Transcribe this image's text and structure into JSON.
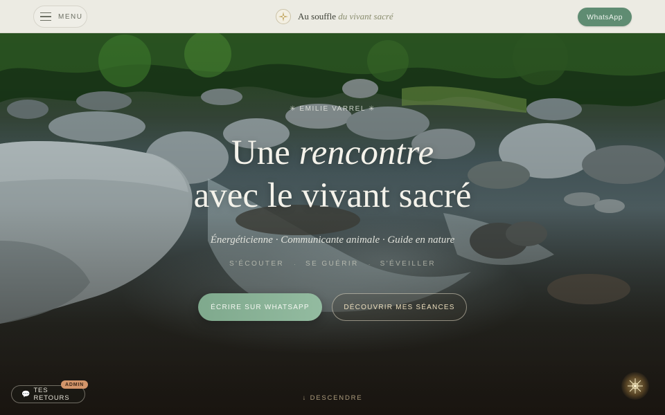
{
  "header": {
    "menu_label": "MENU",
    "brand_name": "Au souffle",
    "brand_tagline": "du vivant sacré",
    "whatsapp_label": "WhatsApp"
  },
  "hero": {
    "eyebrow": "✳ EMILIE VARREL ✳",
    "headline_line1_plain": "Une",
    "headline_line1_italic": "rencontre",
    "headline_line2": "avec le vivant sacré",
    "subtitle": "Énergéticienne · Communicante animale · Guide en nature",
    "triad": [
      "S'ÉCOUTER",
      "SE GUÉRIR",
      "S'ÉVEILLER"
    ],
    "triad_separator": "·",
    "cta_primary": "ÉCRIRE SUR WHATSAPP",
    "cta_secondary": "DÉCOUVRIR MES SÉANCES",
    "scroll_hint": "↓ DESCENDRE"
  },
  "feedback": {
    "icon": "💬",
    "label": "TES RETOURS",
    "badge": "ADMIN"
  },
  "colors": {
    "accent_green": "#5f8c72",
    "cta_green": "#93bba0",
    "badge_orange": "#d3956a",
    "nav_bg": "#ecebe3"
  },
  "icons": {
    "menu": "hamburger-icon",
    "brand": "compass-star-icon",
    "feedback": "speech-bubble-icon",
    "floating": "mandala-icon"
  }
}
